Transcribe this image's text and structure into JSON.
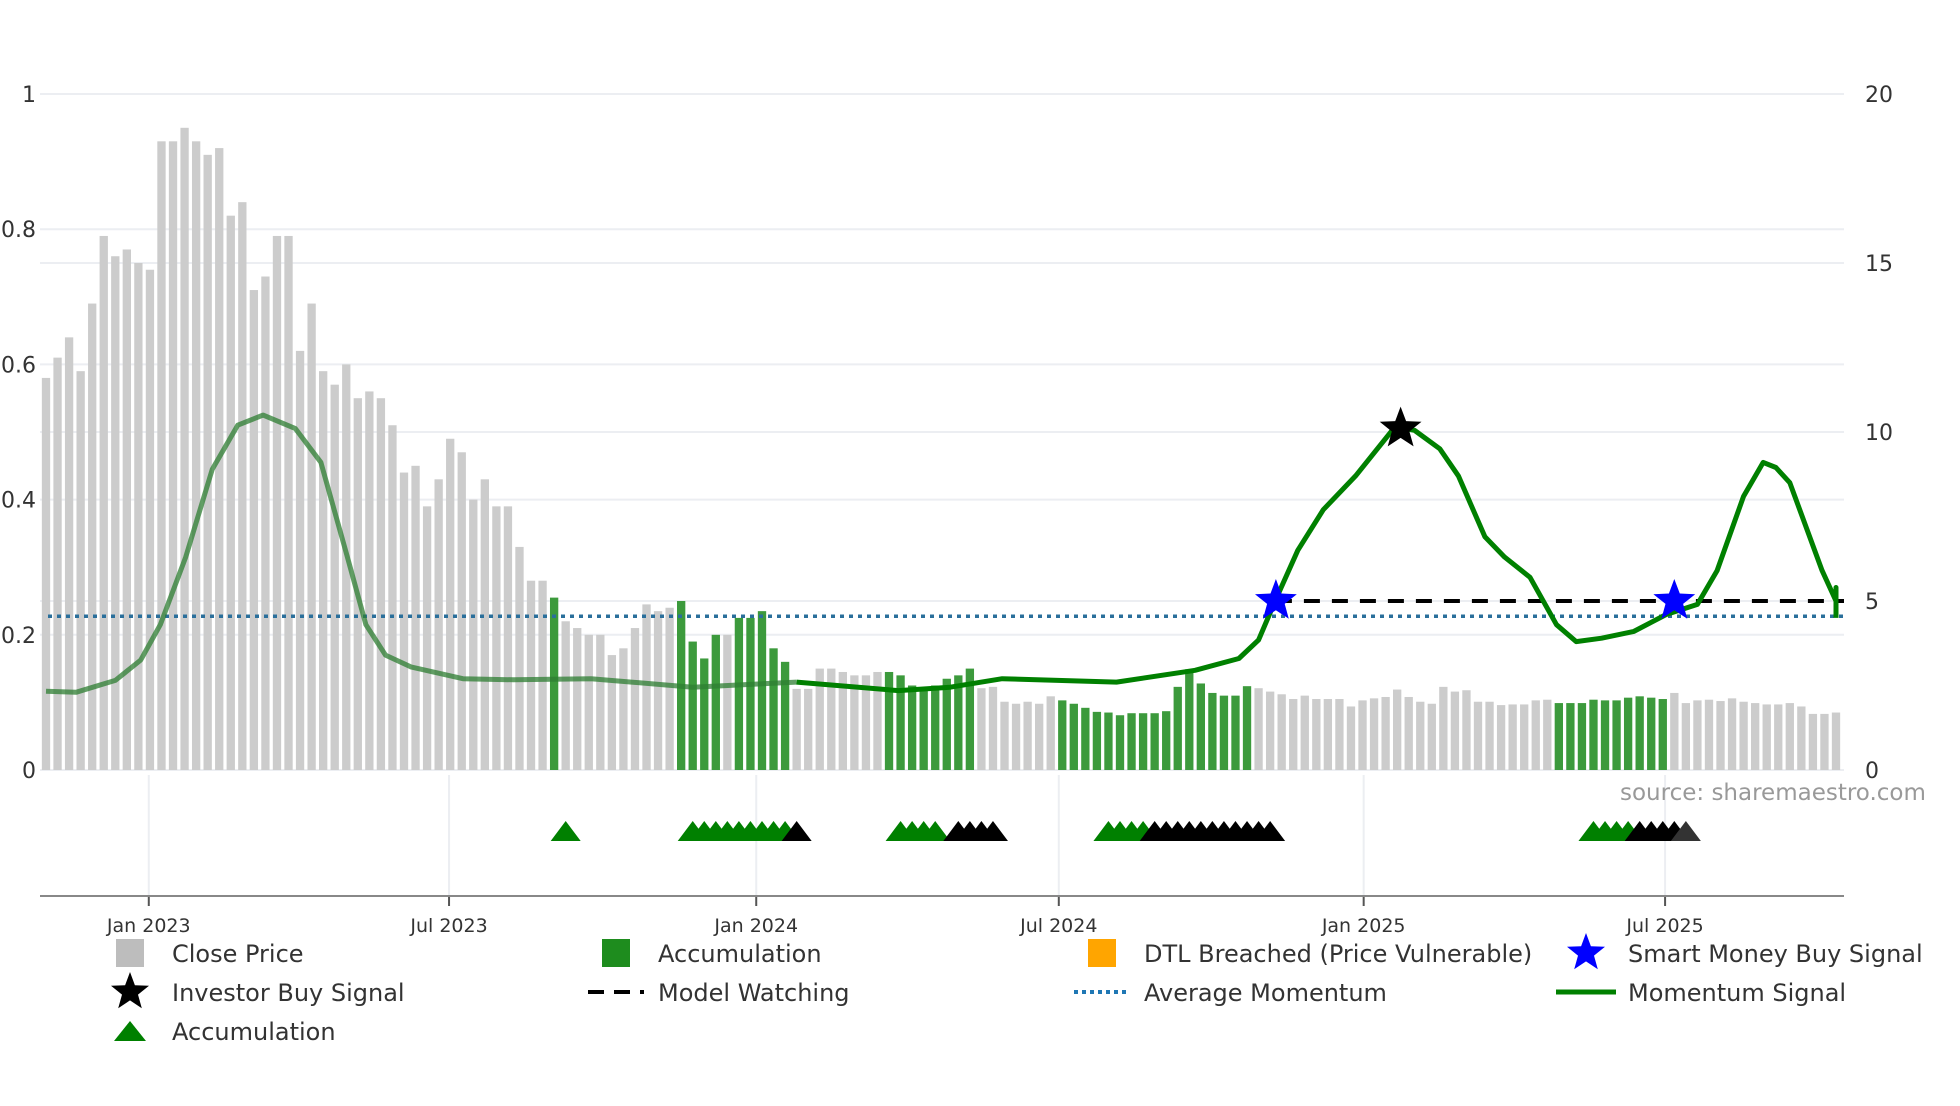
{
  "chart_data": {
    "type": "bar",
    "title": "",
    "source": "source: sharemaestro.com",
    "left_axis": {
      "ylim": [
        0,
        1
      ],
      "ticks": [
        "0",
        "0.2",
        "0.4",
        "0.6",
        "0.8",
        "1"
      ],
      "tick_values": [
        0,
        0.2,
        0.4,
        0.6,
        0.8,
        1
      ]
    },
    "right_axis": {
      "ylim": [
        0,
        20
      ],
      "ticks": [
        "0",
        "5",
        "10",
        "15",
        "20"
      ],
      "tick_values": [
        0,
        5,
        10,
        15,
        20
      ]
    },
    "x_ticks": [
      {
        "label": "Jan 2023",
        "index": 8.9
      },
      {
        "label": "Jul 2023",
        "index": 34.9
      },
      {
        "label": "Jan 2024",
        "index": 61.5
      },
      {
        "label": "Jul 2024",
        "index": 87.7
      },
      {
        "label": "Jan 2025",
        "index": 114.1
      },
      {
        "label": "Jul 2025",
        "index": 140.2
      }
    ],
    "close_price": [
      0.58,
      0.61,
      0.64,
      0.59,
      0.69,
      0.79,
      0.76,
      0.77,
      0.75,
      0.74,
      0.93,
      0.93,
      0.95,
      0.93,
      0.91,
      0.92,
      0.82,
      0.84,
      0.71,
      0.73,
      0.79,
      0.79,
      0.62,
      0.69,
      0.59,
      0.57,
      0.6,
      0.55,
      0.56,
      0.55,
      0.51,
      0.44,
      0.45,
      0.39,
      0.43,
      0.49,
      0.47,
      0.4,
      0.43,
      0.39,
      0.39,
      0.33,
      0.28,
      0.28,
      0.255,
      0.22,
      0.21,
      0.2,
      0.2,
      0.17,
      0.18,
      0.21,
      0.245,
      0.235,
      0.24,
      0.25,
      0.19,
      0.165,
      0.2,
      0.2,
      0.225,
      0.225,
      0.235,
      0.18,
      0.16,
      0.12,
      0.12,
      0.15,
      0.15,
      0.145,
      0.14,
      0.14,
      0.145,
      0.145,
      0.14,
      0.125,
      0.12,
      0.125,
      0.135,
      0.14,
      0.15,
      0.121,
      0.123,
      0.101,
      0.098,
      0.101,
      0.098,
      0.109,
      0.103,
      0.098,
      0.092,
      0.086,
      0.085,
      0.081,
      0.084,
      0.084,
      0.084,
      0.087,
      0.123,
      0.149,
      0.128,
      0.114,
      0.11,
      0.11,
      0.124,
      0.121,
      0.116,
      0.112,
      0.105,
      0.11,
      0.105,
      0.105,
      0.105,
      0.094,
      0.103,
      0.106,
      0.108,
      0.119,
      0.108,
      0.101,
      0.098,
      0.123,
      0.116,
      0.118,
      0.101,
      0.101,
      0.096,
      0.097,
      0.097,
      0.103,
      0.104,
      0.099,
      0.099,
      0.099,
      0.104,
      0.103,
      0.103,
      0.107,
      0.109,
      0.107,
      0.105,
      0.114,
      0.099,
      0.103,
      0.104,
      0.102,
      0.106,
      0.101,
      0.099,
      0.097,
      0.097,
      0.099,
      0.094,
      0.083,
      0.083,
      0.085
    ],
    "accumulation_bars": [
      44,
      55,
      56,
      57,
      58,
      60,
      61,
      62,
      63,
      64,
      73,
      74,
      75,
      76,
      77,
      78,
      79,
      80,
      88,
      89,
      90,
      91,
      92,
      93,
      94,
      95,
      96,
      97,
      98,
      99,
      100,
      101,
      102,
      103,
      104,
      131,
      132,
      133,
      134,
      135,
      136,
      137,
      138,
      139,
      140
    ],
    "momentum_signal": [
      [
        0,
        2.33
      ],
      [
        2.6,
        2.3
      ],
      [
        6,
        2.65
      ],
      [
        8.2,
        3.25
      ],
      [
        9.9,
        4.3
      ],
      [
        12.1,
        6.3
      ],
      [
        14.4,
        8.9
      ],
      [
        16.6,
        10.2
      ],
      [
        18.8,
        10.5
      ],
      [
        21.6,
        10.1
      ],
      [
        23.8,
        9.1
      ],
      [
        26.1,
        6.3
      ],
      [
        27.7,
        4.3
      ],
      [
        29.4,
        3.4
      ],
      [
        31.6,
        3.05
      ],
      [
        36.1,
        2.7
      ],
      [
        40.5,
        2.67
      ],
      [
        47.2,
        2.7
      ],
      [
        56,
        2.45
      ],
      [
        65,
        2.6
      ],
      [
        73.8,
        2.35
      ],
      [
        78.3,
        2.45
      ],
      [
        82.8,
        2.7
      ],
      [
        92.7,
        2.6
      ],
      [
        99.5,
        2.95
      ],
      [
        103.3,
        3.3
      ],
      [
        105,
        3.85
      ],
      [
        106.5,
        5.05
      ],
      [
        108.4,
        6.5
      ],
      [
        110.6,
        7.7
      ],
      [
        113.4,
        8.7
      ],
      [
        116.8,
        10.15
      ],
      [
        118.5,
        10.05
      ],
      [
        120.7,
        9.5
      ],
      [
        122.3,
        8.7
      ],
      [
        124.6,
        6.9
      ],
      [
        126.3,
        6.3
      ],
      [
        128.5,
        5.7
      ],
      [
        130.8,
        4.3
      ],
      [
        132.5,
        3.8
      ],
      [
        134.7,
        3.9
      ],
      [
        137.5,
        4.1
      ],
      [
        140.3,
        4.6
      ],
      [
        143,
        4.9
      ],
      [
        144.7,
        5.9
      ],
      [
        147,
        8.1
      ],
      [
        148.7,
        9.1
      ],
      [
        149.8,
        8.95
      ],
      [
        151,
        8.5
      ],
      [
        153.8,
        5.9
      ],
      [
        156,
        5.0
      ],
      [
        158.3,
        5.4
      ],
      [
        160,
        4.5
      ]
    ],
    "average_momentum": 4.55,
    "model_watching": {
      "value": 5,
      "start_index": 106.5
    },
    "smart_money_buy_signals": [
      [
        106.5,
        5
      ],
      [
        141,
        5
      ]
    ],
    "investor_buy_signals": [
      [
        117.3,
        10.1
      ]
    ],
    "accumulation_markers": {
      "green": [
        45,
        56,
        57,
        58,
        59,
        60,
        61,
        62,
        63,
        64,
        74,
        75,
        76,
        77,
        92,
        93,
        94,
        95,
        134,
        135,
        136,
        137
      ],
      "black": [
        65,
        79,
        80,
        81,
        82,
        96,
        97,
        98,
        99,
        100,
        101,
        102,
        103,
        104,
        105,
        106,
        138,
        139,
        140,
        141
      ],
      "dark": [
        142
      ]
    },
    "legend": [
      {
        "label": "Close Price",
        "symbol": "square",
        "color": "#bdbdbd"
      },
      {
        "label": "Accumulation",
        "symbol": "square",
        "color": "#1e8c1e"
      },
      {
        "label": "DTL Breached (Price Vulnerable)",
        "symbol": "square",
        "color": "#ffa500"
      },
      {
        "label": "Smart Money Buy Signal",
        "symbol": "star",
        "color": "#0000ff"
      },
      {
        "label": "Investor Buy Signal",
        "symbol": "star",
        "color": "#000000"
      },
      {
        "label": "Model Watching",
        "symbol": "dash",
        "color": "#000000"
      },
      {
        "label": "Average Momentum",
        "symbol": "dot",
        "color": "#1f77b4"
      },
      {
        "label": "Momentum Signal",
        "symbol": "line",
        "color": "#008000"
      },
      {
        "label": "Accumulation",
        "symbol": "triangle",
        "color": "#008000"
      }
    ],
    "legend_placement": "bottom"
  }
}
